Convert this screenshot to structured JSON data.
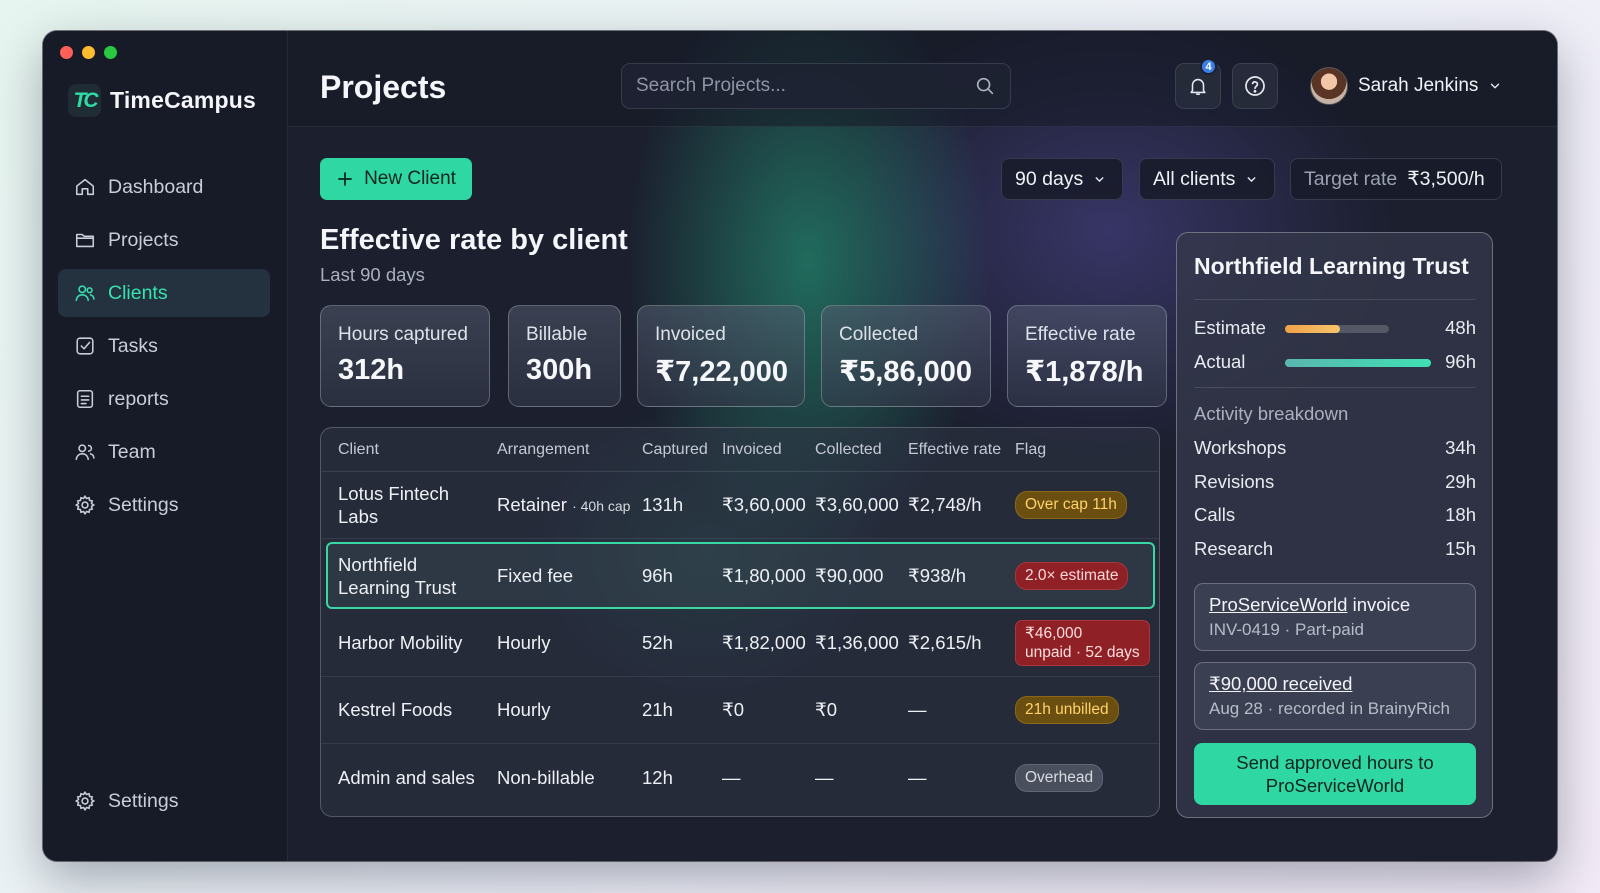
{
  "app": {
    "name": "TimeCampus"
  },
  "sidebar": {
    "items": [
      {
        "label": "Dashboard",
        "icon": "home-icon",
        "active": false
      },
      {
        "label": "Projects",
        "icon": "folder-icon",
        "active": false
      },
      {
        "label": "Clients",
        "icon": "users-icon",
        "active": true
      },
      {
        "label": "Tasks",
        "icon": "checkbox-icon",
        "active": false
      },
      {
        "label": "reports",
        "icon": "document-icon",
        "active": false
      },
      {
        "label": "Team",
        "icon": "team-icon",
        "active": false
      },
      {
        "label": "Settings",
        "icon": "gear-icon",
        "active": false
      }
    ],
    "bottom": {
      "label": "Settings",
      "icon": "gear-icon"
    }
  },
  "header": {
    "title": "Projects",
    "search_placeholder": "Search Projects...",
    "notification_count": "4",
    "user_name": "Sarah Jenkins"
  },
  "toolbar": {
    "new_client": "New Client",
    "range": "90 days",
    "clients_filter": "All clients",
    "target_label": "Target rate",
    "target_value": "₹3,500/h"
  },
  "section": {
    "title": "Effective rate by client",
    "subtitle": "Last 90 days"
  },
  "kpis": [
    {
      "label": "Hours captured",
      "value": "312h"
    },
    {
      "label": "Billable",
      "value": "300h"
    },
    {
      "label": "Invoiced",
      "value": "₹7,22,000"
    },
    {
      "label": "Collected",
      "value": "₹5,86,000"
    },
    {
      "label": "Effective rate",
      "value": "₹1,878/h"
    }
  ],
  "table": {
    "columns": [
      "Client",
      "Arrangement",
      "Captured",
      "Invoiced",
      "Collected",
      "Effective rate",
      "Flag"
    ],
    "rows": [
      {
        "client": "Lotus Fintech Labs",
        "arrangement": "Retainer",
        "arrangement_note": "· 40h cap",
        "captured": "131h",
        "invoiced": "₹3,60,000",
        "collected": "₹3,60,000",
        "rate": "₹2,748/h",
        "flag": "Over cap 11h",
        "flag_color": "#6b4f10"
      },
      {
        "client": "Northfield Learning Trust",
        "arrangement": "Fixed fee",
        "arrangement_note": "",
        "captured": "96h",
        "invoiced": "₹1,80,000",
        "collected": "₹90,000",
        "rate": "₹938/h",
        "flag": "2.0× estimate",
        "flag_color": "#8e2026"
      },
      {
        "client": "Harbor Mobility",
        "arrangement": "Hourly",
        "arrangement_note": "",
        "captured": "52h",
        "invoiced": "₹1,82,000",
        "collected": "₹1,36,000",
        "rate": "₹2,615/h",
        "flag": "₹46,000",
        "flag_line2": "unpaid · 52 days",
        "flag_color": "#8e2026"
      },
      {
        "client": "Kestrel Foods",
        "arrangement": "Hourly",
        "arrangement_note": "",
        "captured": "21h",
        "invoiced": "₹0",
        "collected": "₹0",
        "rate": "—",
        "flag": "21h unbilled",
        "flag_color": "#6b4f10"
      },
      {
        "client": "Admin and sales",
        "arrangement": "Non-billable",
        "arrangement_note": "",
        "captured": "12h",
        "invoiced": "—",
        "collected": "—",
        "rate": "—",
        "flag": "Overhead",
        "flag_color": "#4a4f5e"
      }
    ]
  },
  "detail": {
    "title": "Northfield Learning Trust",
    "estimate_label": "Estimate",
    "estimate_value": "48h",
    "estimate_progress": 0.53,
    "actual_label": "Actual",
    "actual_value": "96h",
    "actual_progress": 1.0,
    "breakdown_title": "Activity breakdown",
    "breakdown": [
      {
        "label": "Workshops",
        "value": "34h"
      },
      {
        "label": "Revisions",
        "value": "29h"
      },
      {
        "label": "Calls",
        "value": "18h"
      },
      {
        "label": "Research",
        "value": "15h"
      }
    ],
    "invoice_link": "ProServiceWorld",
    "invoice_title_rest": " invoice",
    "invoice_sub": "INV-0419 · Part-paid",
    "payment_title": "₹90,000 received",
    "payment_sub": "Aug 28 · recorded in BrainyRich",
    "send_button": "Send approved hours to ProServiceWorld"
  },
  "colors": {
    "accent": "#2fd7a2",
    "warning": "#ffd26a",
    "danger": "#8e2026"
  }
}
